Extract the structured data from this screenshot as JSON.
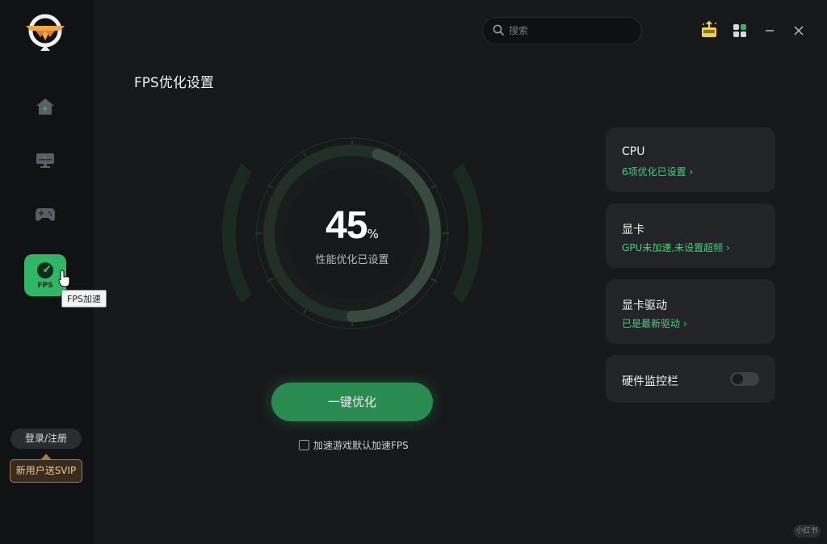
{
  "sidebar": {
    "fps_label": "FPS",
    "tooltip": "FPS加速",
    "login_label": "登录/注册",
    "svip_label": "新用户送SVIP"
  },
  "header": {
    "search_placeholder": "搜索"
  },
  "main": {
    "title": "FPS优化设置",
    "gauge": {
      "value": "45",
      "unit": "%",
      "progress": 0.45,
      "caption": "性能优化已设置"
    },
    "optimize_button": "一键优化",
    "checkbox_label": "加速游戏默认加速FPS"
  },
  "cards": [
    {
      "title": "CPU",
      "status": "6项优化已设置"
    },
    {
      "title": "显卡",
      "status": "GPU未加速,未设置超频"
    },
    {
      "title": "显卡驱动",
      "status": "已是最新驱动"
    },
    {
      "title": "硬件监控栏",
      "toggle_on": false
    }
  ],
  "colors": {
    "accent": "#2fb765",
    "status_text": "#3fd27b",
    "background": "#17181a",
    "sidebar": "#111213"
  },
  "watermark": "小红书"
}
